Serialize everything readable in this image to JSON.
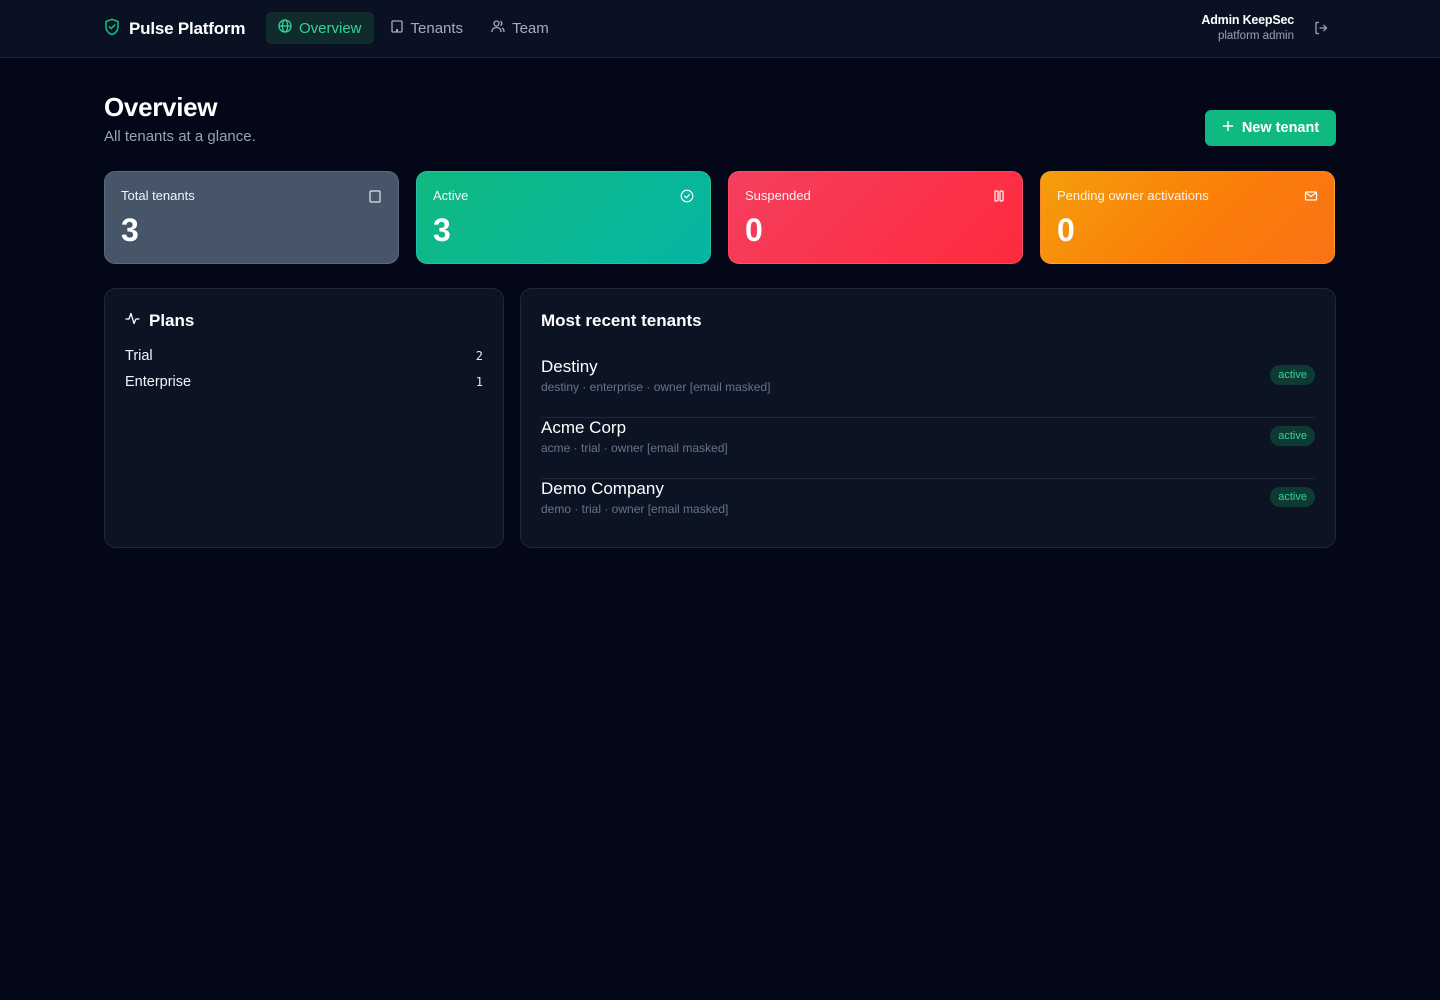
{
  "app": {
    "brand": "Pulse Platform"
  },
  "nav": [
    {
      "label": "Overview",
      "icon": "globe-icon",
      "active": true
    },
    {
      "label": "Tenants",
      "icon": "building-icon",
      "active": false
    },
    {
      "label": "Team",
      "icon": "users-icon",
      "active": false
    }
  ],
  "user": {
    "name": "Admin KeepSec",
    "role": "platform admin"
  },
  "header": {
    "title": "Overview",
    "subtitle": "All tenants at a glance.",
    "new_button": "New tenant"
  },
  "stats": [
    {
      "label": "Total tenants",
      "value": "3",
      "icon": "building-icon",
      "color": "#475569"
    },
    {
      "label": "Active",
      "value": "3",
      "icon": "check-circle-icon",
      "color": "#10b981"
    },
    {
      "label": "Suspended",
      "value": "0",
      "icon": "pause-icon",
      "color": "#f43f5e"
    },
    {
      "label": "Pending owner activations",
      "value": "0",
      "icon": "mail-icon",
      "color": "#f59e0b"
    }
  ],
  "plans": {
    "title": "Plans",
    "items": [
      {
        "name": "Trial",
        "count": "2"
      },
      {
        "name": "Enterprise",
        "count": "1"
      }
    ]
  },
  "recent": {
    "title": "Most recent tenants",
    "items": [
      {
        "name": "Destiny",
        "meta": "destiny · enterprise · owner [email masked]",
        "status": "active"
      },
      {
        "name": "Acme Corp",
        "meta": "acme · trial · owner [email masked]",
        "status": "active"
      },
      {
        "name": "Demo Company",
        "meta": "demo · trial · owner [email masked]",
        "status": "active"
      }
    ]
  },
  "colors": {
    "accent": "#10b981",
    "background": "#030718",
    "panel": "#0c1424"
  }
}
